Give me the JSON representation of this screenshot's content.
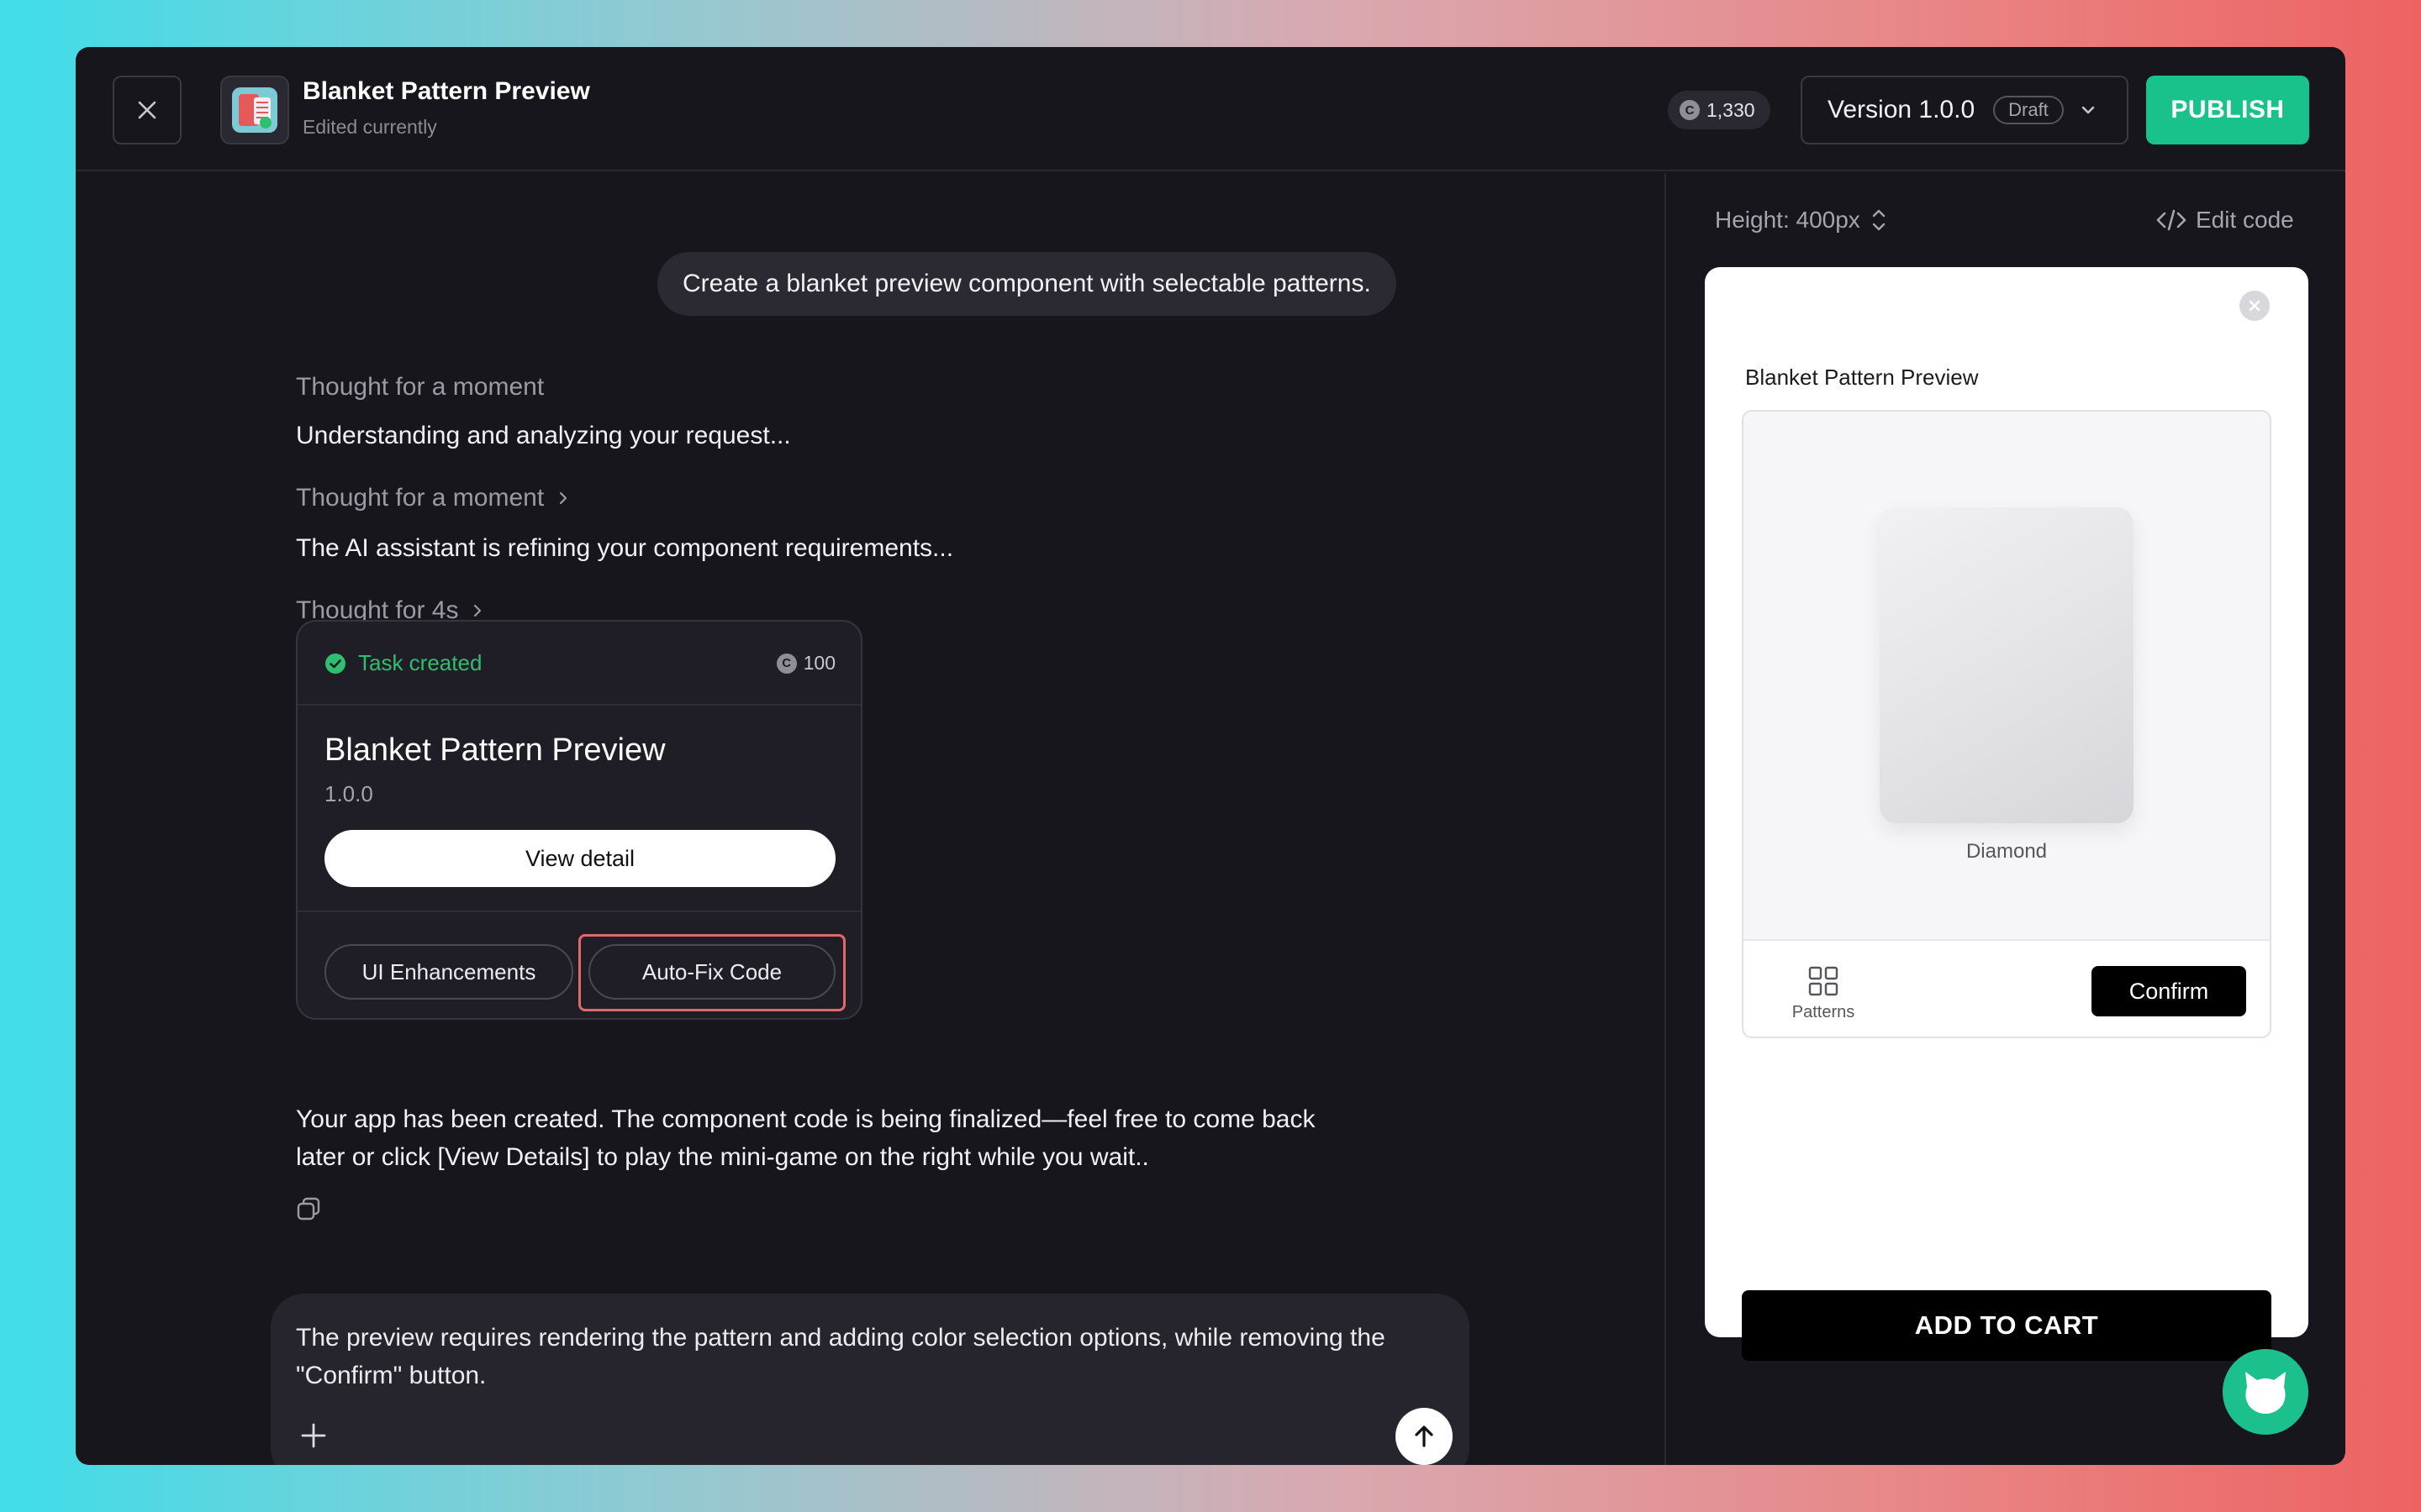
{
  "header": {
    "app_title": "Blanket Pattern Preview",
    "app_subtitle": "Edited currently",
    "credits": "1,330",
    "coin_symbol": "C",
    "version_label": "Version 1.0.0",
    "version_status": "Draft",
    "publish_label": "PUBLISH"
  },
  "chat": {
    "user_message": "Create a blanket preview component with selectable patterns.",
    "thought_1": "Thought for a moment",
    "text_1": "Understanding and analyzing your request...",
    "thought_2": "Thought for a moment",
    "text_2": "The AI assistant is refining your component requirements...",
    "thought_3": "Thought for 4s",
    "task_card": {
      "status": "Task created",
      "cost": "100",
      "title": "Blanket Pattern Preview",
      "version": "1.0.0",
      "view_detail_label": "View detail",
      "chip_1": "UI Enhancements",
      "chip_2": "Auto-Fix Code"
    },
    "result_line_1": "Your app has been created. The component code is being finalized—feel free to come back",
    "result_line_2": "later or click [View Details] to play the mini-game on the right while you wait..",
    "composer_text": "The preview requires rendering the pattern and adding color selection options, while removing the \"Confirm\" button."
  },
  "preview": {
    "height_label": "Height: 400px",
    "edit_code_label": "Edit code",
    "card_title": "Blanket Pattern Preview",
    "pattern_name": "Diamond",
    "patterns_label": "Patterns",
    "confirm_label": "Confirm",
    "add_to_cart_label": "ADD TO CART"
  },
  "colors": {
    "accent_green": "#19c18b",
    "task_green": "#2fbf71",
    "highlight_red": "#e06a6a",
    "window_bg": "#17161d"
  },
  "icons": [
    "close-icon",
    "app-icon",
    "coin-icon",
    "chevron-down-icon",
    "chevron-right-icon",
    "check-circle-icon",
    "copy-icon",
    "plus-icon",
    "arrow-up-icon",
    "sort-icon",
    "code-icon",
    "grid-icon",
    "cat-icon"
  ]
}
